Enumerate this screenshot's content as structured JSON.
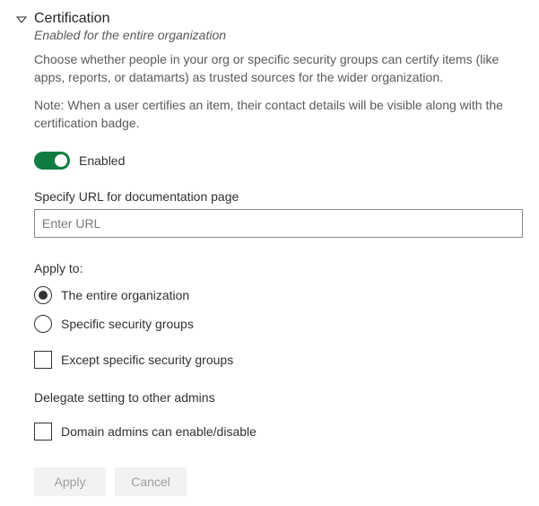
{
  "header": {
    "title": "Certification",
    "subtitle": "Enabled for the entire organization"
  },
  "description": "Choose whether people in your org or specific security groups can certify items (like apps, reports, or datamarts) as trusted sources for the wider organization.",
  "note": "Note: When a user certifies an item, their contact details will be visible along with the certification badge.",
  "toggle": {
    "state": "on",
    "label": "Enabled"
  },
  "url_field": {
    "label": "Specify URL for documentation page",
    "placeholder": "Enter URL",
    "value": ""
  },
  "apply_to": {
    "label": "Apply to:",
    "options": [
      {
        "label": "The entire organization",
        "selected": true
      },
      {
        "label": "Specific security groups",
        "selected": false
      }
    ],
    "except": {
      "label": "Except specific security groups",
      "checked": false
    }
  },
  "delegate": {
    "label": "Delegate setting to other admins",
    "option": {
      "label": "Domain admins can enable/disable",
      "checked": false
    }
  },
  "buttons": {
    "apply": "Apply",
    "cancel": "Cancel"
  }
}
